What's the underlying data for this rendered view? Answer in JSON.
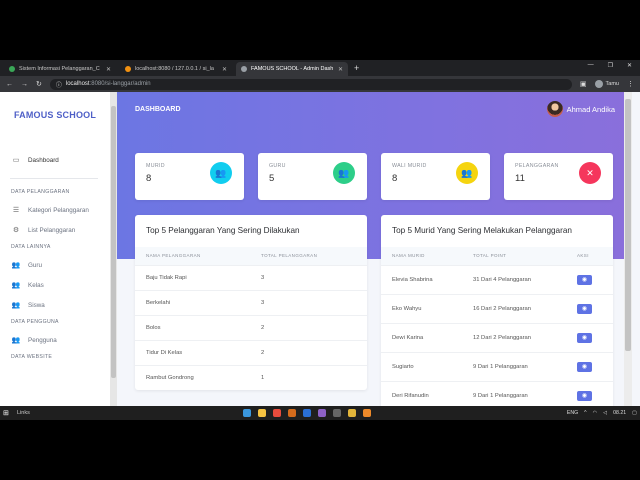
{
  "browser": {
    "tabs": [
      {
        "title": "Sistem Informasi Pelanggaran_C",
        "color": "#3aa757"
      },
      {
        "title": "localhost:8080 / 127.0.0.1 / si_la",
        "color": "#f29111"
      },
      {
        "title": "FAMOUS SCHOOL - Admin Dash",
        "color": "#9aa0a6"
      }
    ],
    "new_tab": "+",
    "url_host": "localhost",
    "url_rest": ":8080/si-langgar/admin",
    "profile": "Tamu"
  },
  "sidebar": {
    "brand": "FAMOUS SCHOOL",
    "dashboard": "Dashboard",
    "sections": [
      {
        "title": "DATA PELANGGARAN",
        "items": [
          "Kategori Pelanggaran",
          "List Pelanggaran"
        ]
      },
      {
        "title": "DATA LAINNYA",
        "items": [
          "Guru",
          "Kelas",
          "Siswa"
        ]
      },
      {
        "title": "DATA PENGGUNA",
        "items": [
          "Pengguna"
        ]
      },
      {
        "title": "DATA WEBSITE",
        "items": []
      }
    ]
  },
  "header": {
    "title": "DASHBOARD",
    "user": "Ahmad Andika"
  },
  "stats": [
    {
      "label": "MURID",
      "value": "8",
      "color": "#11cdef",
      "icon": "users-icon"
    },
    {
      "label": "GURU",
      "value": "5",
      "color": "#2dce89",
      "icon": "users-icon"
    },
    {
      "label": "WALI MURID",
      "value": "8",
      "color": "#f5d40f",
      "icon": "users-icon"
    },
    {
      "label": "PELANGGARAN",
      "value": "11",
      "color": "#f5365c",
      "icon": "x-circle-icon"
    }
  ],
  "pelanggaran_card": {
    "title": "Top 5 Pelanggaran Yang Sering Dilakukan",
    "headers": [
      "NAMA PELANGGARAN",
      "TOTAL PELANGGARAN"
    ],
    "rows": [
      [
        "Baju Tidak Rapi",
        "3"
      ],
      [
        "Berkelahi",
        "3"
      ],
      [
        "Bolos",
        "2"
      ],
      [
        "Tidur Di Kelas",
        "2"
      ],
      [
        "Rambut Gondrong",
        "1"
      ]
    ]
  },
  "murid_card": {
    "title": "Top 5 Murid Yang Sering Melakukan Pelanggaran",
    "headers": [
      "NAMA MURID",
      "TOTAL POINT",
      "AKSI"
    ],
    "rows": [
      [
        "Elevia Shabrina",
        "31 Dari 4 Pelanggaran"
      ],
      [
        "Eko Wahyu",
        "16 Dari 2 Pelanggaran"
      ],
      [
        "Dewi Karina",
        "12 Dari 2 Pelanggaran"
      ],
      [
        "Sugiarto",
        "9 Dari 1 Pelanggaran"
      ],
      [
        "Deri Rifanudin",
        "9 Dari 1 Pelanggaran"
      ]
    ]
  },
  "taskbar": {
    "search": "Links",
    "time": "08.21",
    "lang": "ENG"
  }
}
